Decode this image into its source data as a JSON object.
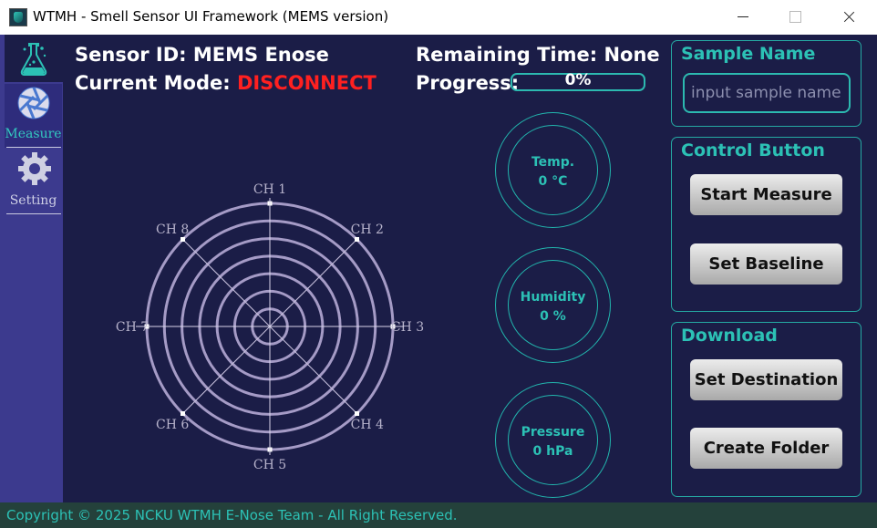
{
  "window": {
    "title": "WTMH - Smell Sensor UI Framework (MEMS version)"
  },
  "sidebar": {
    "items": [
      {
        "label": "Measure",
        "icon": "aperture-icon",
        "active": true
      },
      {
        "label": "Setting",
        "icon": "gear-icon",
        "active": false
      }
    ]
  },
  "header": {
    "sensor_label": "Sensor ID:",
    "sensor_id": "MEMS Enose",
    "mode_label": "Current Mode:",
    "mode": "DISCONNECT",
    "remaining_label": "Remaining Time:",
    "remaining": "None",
    "progress_label": "Progress:",
    "progress_text": "0%",
    "progress_value": 0
  },
  "radar": {
    "channels": [
      "CH 1",
      "CH 2",
      "CH 3",
      "CH 4",
      "CH 5",
      "CH 6",
      "CH 7",
      "CH 8"
    ]
  },
  "gauges": [
    {
      "label": "Temp.",
      "value": "0 °C"
    },
    {
      "label": "Humidity",
      "value": "0 %"
    },
    {
      "label": "Pressure",
      "value": "0 hPa"
    }
  ],
  "sample_panel": {
    "title": "Sample Name",
    "placeholder": "input sample name"
  },
  "control_panel": {
    "title": "Control Button",
    "start_label": "Start Measure",
    "baseline_label": "Set Baseline"
  },
  "download_panel": {
    "title": "Download",
    "destination_label": "Set Destination",
    "folder_label": "Create Folder"
  },
  "footer": {
    "text": "Copyright © 2025 NCKU WTMH E-Nose Team - All Right Reserved."
  },
  "colors": {
    "background": "#1b1d47",
    "sidebar": "#3c3a8e",
    "accent": "#2cc1b5",
    "alert": "#ff2020",
    "radar": "#a59bc6"
  }
}
